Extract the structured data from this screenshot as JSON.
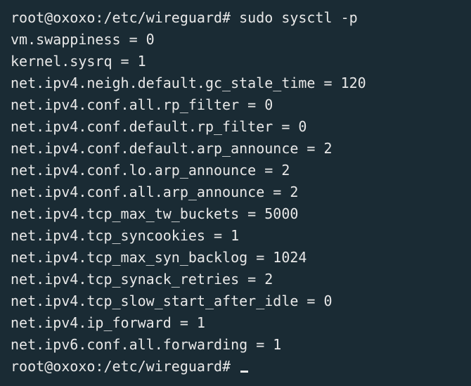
{
  "lines": [
    "root@oxoxo:/etc/wireguard# sudo sysctl -p",
    "vm.swappiness = 0",
    "kernel.sysrq = 1",
    "net.ipv4.neigh.default.gc_stale_time = 120",
    "net.ipv4.conf.all.rp_filter = 0",
    "net.ipv4.conf.default.rp_filter = 0",
    "net.ipv4.conf.default.arp_announce = 2",
    "net.ipv4.conf.lo.arp_announce = 2",
    "net.ipv4.conf.all.arp_announce = 2",
    "net.ipv4.tcp_max_tw_buckets = 5000",
    "net.ipv4.tcp_syncookies = 1",
    "net.ipv4.tcp_max_syn_backlog = 1024",
    "net.ipv4.tcp_synack_retries = 2",
    "net.ipv4.tcp_slow_start_after_idle = 0",
    "net.ipv4.ip_forward = 1",
    "net.ipv6.conf.all.forwarding = 1",
    "root@oxoxo:/etc/wireguard# "
  ]
}
